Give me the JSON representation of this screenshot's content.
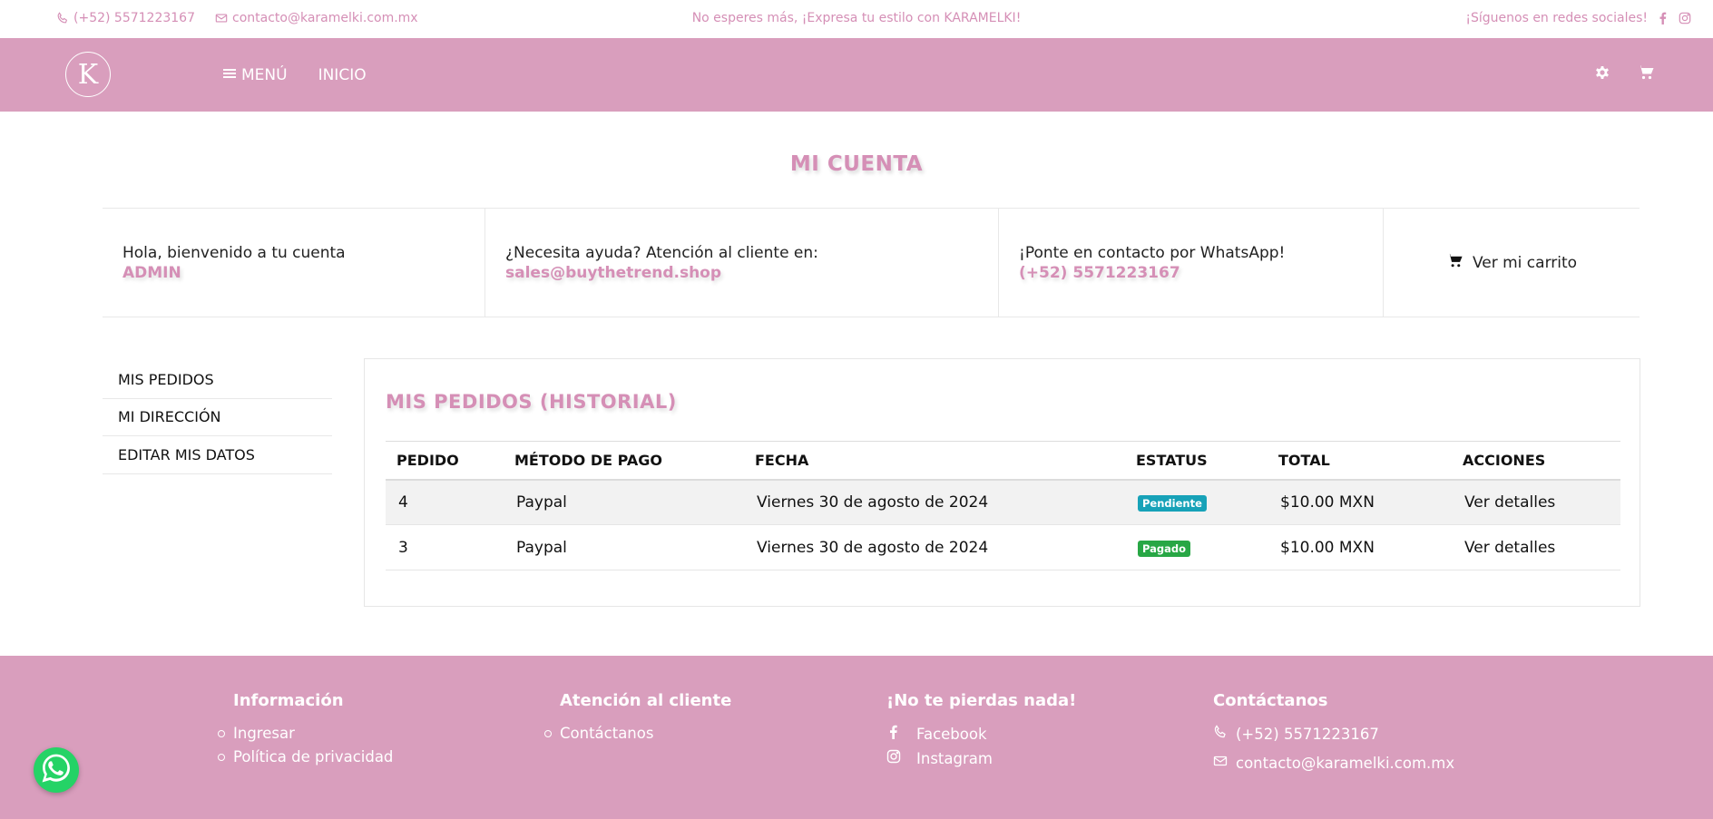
{
  "topbar": {
    "phone": "(+52) 5571223167",
    "email": "contacto@karamelki.com.mx",
    "promo": "No esperes más, ¡Expresa tu estilo con KARAMELKI!",
    "social_label": "¡Síguenos en redes sociales!"
  },
  "navbar": {
    "logo_letter": "K",
    "menu_label": "MENÚ",
    "home_label": "INICIO"
  },
  "page": {
    "title": "MI CUENTA"
  },
  "info": {
    "welcome_text": "Hola, bienvenido a tu cuenta",
    "username": "ADMIN",
    "help_text": "¿Necesita ayuda? Atención al cliente en:",
    "help_email": "sales@buythetrend.shop",
    "whatsapp_text": "¡Ponte en contacto por WhatsApp!",
    "whatsapp_phone": "(+52) 5571223167",
    "cart_label": "Ver mi carrito"
  },
  "sidebar": {
    "items": [
      {
        "label": "MIS PEDIDOS"
      },
      {
        "label": "MI DIRECCIÓN"
      },
      {
        "label": "EDITAR MIS DATOS"
      }
    ]
  },
  "orders": {
    "title": "MIS PEDIDOS (HISTORIAL)",
    "headers": [
      "PEDIDO",
      "MÉTODO DE PAGO",
      "FECHA",
      "ESTATUS",
      "TOTAL",
      "ACCIONES"
    ],
    "rows": [
      {
        "id": "4",
        "method": "Paypal",
        "date": "Viernes 30 de agosto de 2024",
        "status": "Pendiente",
        "total": "$10.00 MXN",
        "action": "Ver detalles"
      },
      {
        "id": "3",
        "method": "Paypal",
        "date": "Viernes 30 de agosto de 2024",
        "status": "Pagado",
        "total": "$10.00 MXN",
        "action": "Ver detalles"
      }
    ]
  },
  "footer": {
    "info_title": "Información",
    "info_links": [
      "Ingresar",
      "Política de privacidad"
    ],
    "support_title": "Atención al cliente",
    "support_links": [
      "Contáctanos"
    ],
    "social_title": "¡No te pierdas nada!",
    "social_links": [
      "Facebook",
      "Instagram"
    ],
    "contact_title": "Contáctanos",
    "contact_phone": "(+52) 5571223167",
    "contact_email": "contacto@karamelki.com.mx"
  },
  "colors": {
    "brand_pink": "#d99ebd",
    "accent_text": "#d58fb6",
    "status_pending": "#17a2b8",
    "status_paid": "#28a745",
    "whatsapp_green": "#25d366"
  },
  "icons": {
    "phone": "phone-icon",
    "email": "envelope-icon",
    "facebook": "facebook-icon",
    "instagram": "instagram-icon",
    "menu": "hamburger-icon",
    "settings": "gear-icon",
    "cart": "cart-icon",
    "whatsapp": "whatsapp-icon"
  }
}
